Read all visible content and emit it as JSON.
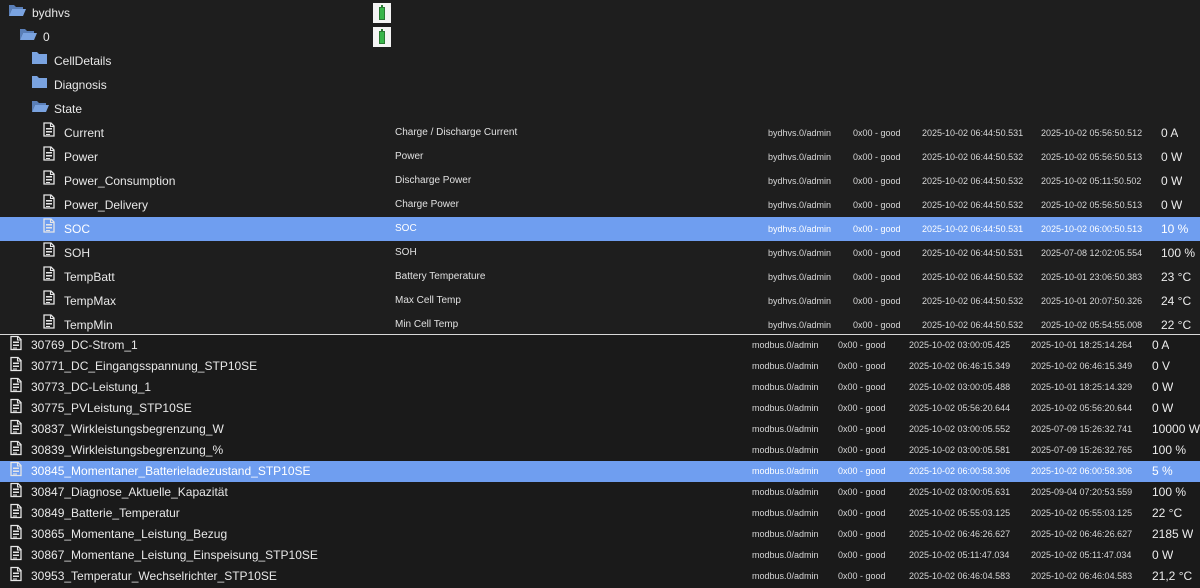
{
  "tree": {
    "adapter": "bydhvs",
    "instance": "0",
    "folders": [
      "CellDetails",
      "Diagnosis",
      "State"
    ]
  },
  "icons": {
    "folder_closed": "folder-icon",
    "folder_open": "folder-open-icon",
    "state": "file-icon",
    "adapter": "battery-icon"
  },
  "colors": {
    "selection": "#6f9ef0",
    "background": "#1e1e1e",
    "battery": "#39b54a"
  },
  "state_rows": [
    {
      "name": "Current",
      "desc": "Charge / Discharge Current",
      "from": "bydhvs.0/admin",
      "quality": "0x00 - good",
      "ts": "2025-10-02 06:44:50.531",
      "lc": "2025-10-02 05:56:50.512",
      "value": "0 A"
    },
    {
      "name": "Power",
      "desc": "Power",
      "from": "bydhvs.0/admin",
      "quality": "0x00 - good",
      "ts": "2025-10-02 06:44:50.532",
      "lc": "2025-10-02 05:56:50.513",
      "value": "0 W"
    },
    {
      "name": "Power_Consumption",
      "desc": "Discharge Power",
      "from": "bydhvs.0/admin",
      "quality": "0x00 - good",
      "ts": "2025-10-02 06:44:50.532",
      "lc": "2025-10-02 05:11:50.502",
      "value": "0 W"
    },
    {
      "name": "Power_Delivery",
      "desc": "Charge Power",
      "from": "bydhvs.0/admin",
      "quality": "0x00 - good",
      "ts": "2025-10-02 06:44:50.532",
      "lc": "2025-10-02 05:56:50.513",
      "value": "0 W"
    },
    {
      "name": "SOC",
      "desc": "SOC",
      "from": "bydhvs.0/admin",
      "quality": "0x00 - good",
      "ts": "2025-10-02 06:44:50.531",
      "lc": "2025-10-02 06:00:50.513",
      "value": "10 %",
      "selected": true
    },
    {
      "name": "SOH",
      "desc": "SOH",
      "from": "bydhvs.0/admin",
      "quality": "0x00 - good",
      "ts": "2025-10-02 06:44:50.531",
      "lc": "2025-07-08 12:02:05.554",
      "value": "100 %"
    },
    {
      "name": "TempBatt",
      "desc": "Battery Temperature",
      "from": "bydhvs.0/admin",
      "quality": "0x00 - good",
      "ts": "2025-10-02 06:44:50.532",
      "lc": "2025-10-01 23:06:50.383",
      "value": "23 °C"
    },
    {
      "name": "TempMax",
      "desc": "Max Cell Temp",
      "from": "bydhvs.0/admin",
      "quality": "0x00 - good",
      "ts": "2025-10-02 06:44:50.532",
      "lc": "2025-10-01 20:07:50.326",
      "value": "24 °C"
    },
    {
      "name": "TempMin",
      "desc": "Min Cell Temp",
      "from": "bydhvs.0/admin",
      "quality": "0x00 - good",
      "ts": "2025-10-02 06:44:50.532",
      "lc": "2025-10-02 05:54:55.008",
      "value": "22 °C"
    }
  ],
  "modbus_rows": [
    {
      "name": "30769_DC-Strom_1",
      "from": "modbus.0/admin",
      "quality": "0x00 - good",
      "ts": "2025-10-02 03:00:05.425",
      "lc": "2025-10-01 18:25:14.264",
      "value": "0 A"
    },
    {
      "name": "30771_DC_Eingangsspannung_STP10SE",
      "from": "modbus.0/admin",
      "quality": "0x00 - good",
      "ts": "2025-10-02 06:46:15.349",
      "lc": "2025-10-02 06:46:15.349",
      "value": "0 V"
    },
    {
      "name": "30773_DC-Leistung_1",
      "from": "modbus.0/admin",
      "quality": "0x00 - good",
      "ts": "2025-10-02 03:00:05.488",
      "lc": "2025-10-01 18:25:14.329",
      "value": "0 W"
    },
    {
      "name": "30775_PVLeistung_STP10SE",
      "from": "modbus.0/admin",
      "quality": "0x00 - good",
      "ts": "2025-10-02 05:56:20.644",
      "lc": "2025-10-02 05:56:20.644",
      "value": "0 W"
    },
    {
      "name": "30837_Wirkleistungsbegrenzung_W",
      "from": "modbus.0/admin",
      "quality": "0x00 - good",
      "ts": "2025-10-02 03:00:05.552",
      "lc": "2025-07-09 15:26:32.741",
      "value": "10000 W"
    },
    {
      "name": "30839_Wirkleistungsbegrenzung_%",
      "from": "modbus.0/admin",
      "quality": "0x00 - good",
      "ts": "2025-10-02 03:00:05.581",
      "lc": "2025-07-09 15:26:32.765",
      "value": "100 %"
    },
    {
      "name": "30845_Momentaner_Batterieladezustand_STP10SE",
      "from": "modbus.0/admin",
      "quality": "0x00 - good",
      "ts": "2025-10-02 06:00:58.306",
      "lc": "2025-10-02 06:00:58.306",
      "value": "5 %",
      "selected": true
    },
    {
      "name": "30847_Diagnose_Aktuelle_Kapazität",
      "from": "modbus.0/admin",
      "quality": "0x00 - good",
      "ts": "2025-10-02 03:00:05.631",
      "lc": "2025-09-04 07:20:53.559",
      "value": "100 %"
    },
    {
      "name": "30849_Batterie_Temperatur",
      "from": "modbus.0/admin",
      "quality": "0x00 - good",
      "ts": "2025-10-02 05:55:03.125",
      "lc": "2025-10-02 05:55:03.125",
      "value": "22 °C"
    },
    {
      "name": "30865_Momentane_Leistung_Bezug",
      "from": "modbus.0/admin",
      "quality": "0x00 - good",
      "ts": "2025-10-02 06:46:26.627",
      "lc": "2025-10-02 06:46:26.627",
      "value": "2185 W"
    },
    {
      "name": "30867_Momentane_Leistung_Einspeisung_STP10SE",
      "from": "modbus.0/admin",
      "quality": "0x00 - good",
      "ts": "2025-10-02 05:11:47.034",
      "lc": "2025-10-02 05:11:47.034",
      "value": "0 W"
    },
    {
      "name": "30953_Temperatur_Wechselrichter_STP10SE",
      "from": "modbus.0/admin",
      "quality": "0x00 - good",
      "ts": "2025-10-02 06:46:04.583",
      "lc": "2025-10-02 06:46:04.583",
      "value": "21,2 °C"
    }
  ]
}
